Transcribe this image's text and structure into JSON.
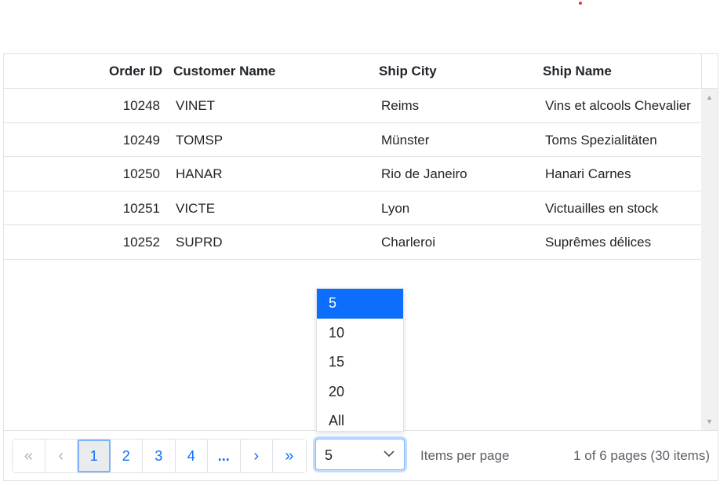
{
  "grid": {
    "columns": [
      "Order ID",
      "Customer Name",
      "Ship City",
      "Ship Name"
    ],
    "rows": [
      {
        "order_id": "10248",
        "customer": "VINET",
        "city": "Reims",
        "ship": "Vins et alcools Chevalier"
      },
      {
        "order_id": "10249",
        "customer": "TOMSP",
        "city": "Münster",
        "ship": "Toms Spezialitäten"
      },
      {
        "order_id": "10250",
        "customer": "HANAR",
        "city": "Rio de Janeiro",
        "ship": "Hanari Carnes"
      },
      {
        "order_id": "10251",
        "customer": "VICTE",
        "city": "Lyon",
        "ship": "Victuailles en stock"
      },
      {
        "order_id": "10252",
        "customer": "SUPRD",
        "city": "Charleroi",
        "ship": "Suprêmes délices"
      }
    ]
  },
  "scrollbar": {
    "up_icon": "▲",
    "down_icon": "▼"
  },
  "pager": {
    "first": "«",
    "prev": "‹",
    "pages": [
      "1",
      "2",
      "3",
      "4"
    ],
    "active_page": "1",
    "more": "...",
    "next": "›",
    "last": "»",
    "page_size_value": "5",
    "items_per_page_label": "Items per page",
    "info": "1 of 6 pages (30 items)"
  },
  "page_size_dropdown": {
    "options": [
      "5",
      "10",
      "15",
      "20",
      "All"
    ],
    "selected": "5"
  },
  "colors": {
    "accent": "#0d6efd",
    "border": "#dee2e6",
    "active_page_bg": "#e9ecef"
  }
}
